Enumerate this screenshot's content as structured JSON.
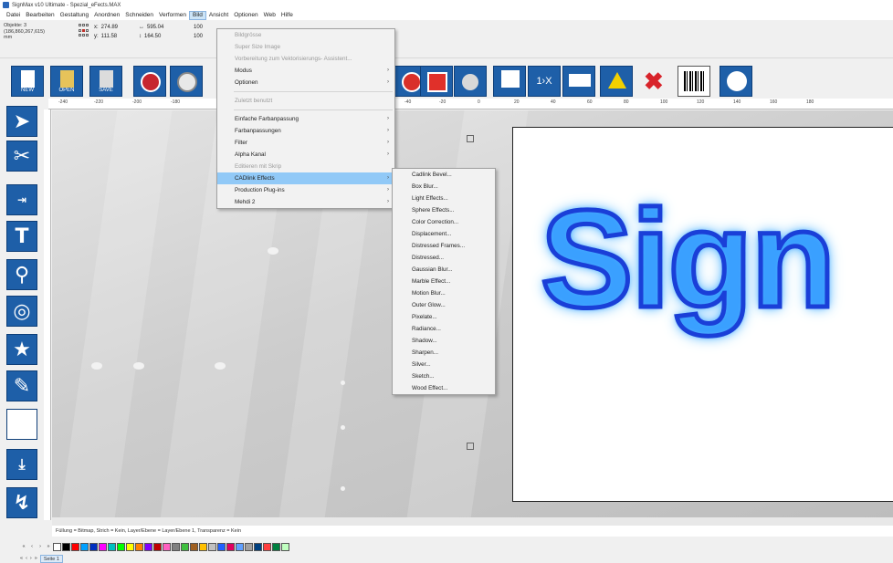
{
  "window": {
    "title": "SignMax v10 Ultimate - Spezial_eFects.MAX"
  },
  "menubar": {
    "items": [
      "Datei",
      "Bearbeiten",
      "Gestaltung",
      "Anordnen",
      "Schneiden",
      "Verformen",
      "Bild",
      "Ansicht",
      "Optionen",
      "Web",
      "Hilfe"
    ],
    "active": "Bild"
  },
  "object_info": {
    "line1": "Objekte: 3",
    "line2": "(186,860,267,615)",
    "line3": "mm"
  },
  "coords": {
    "x_label": "x:",
    "x": "274.89",
    "y_label": "y:",
    "y": "111.58",
    "w": "595.04",
    "h": "164.50",
    "sx": "100",
    "sy": "100"
  },
  "toolbar": {
    "new_label": "NEW",
    "open_label": "OPEN",
    "save_label": "SAVE"
  },
  "ruler_h_labels": [
    "-240",
    "-220",
    "-200",
    "-180",
    "-40",
    "-20",
    "0",
    "20",
    "40",
    "60",
    "80",
    "100",
    "120",
    "140",
    "160",
    "180"
  ],
  "bild_menu": {
    "items": [
      {
        "label": "Bildgrösse",
        "disabled": true,
        "submenu": false
      },
      {
        "label": "Super Size Image",
        "disabled": true,
        "submenu": false
      },
      {
        "label": "Vorbereitung zum Vektorisierungs- Assistent...",
        "disabled": true,
        "submenu": false
      },
      {
        "label": "Modus",
        "disabled": false,
        "submenu": true
      },
      {
        "label": "Optionen",
        "disabled": false,
        "submenu": true
      },
      {
        "label": "Zuletzt benutzt",
        "disabled": true,
        "submenu": false
      },
      {
        "label": "Einfache Farbanpassung",
        "disabled": false,
        "submenu": true
      },
      {
        "label": "Farbanpassungen",
        "disabled": false,
        "submenu": true
      },
      {
        "label": "Filter",
        "disabled": false,
        "submenu": true
      },
      {
        "label": "Alpha Kanal",
        "disabled": false,
        "submenu": true
      },
      {
        "label": "Editieren mit Skrip",
        "disabled": true,
        "submenu": false
      },
      {
        "label": "CADlink Effects",
        "disabled": false,
        "submenu": true,
        "highlighted": true
      },
      {
        "label": "Production Plug-ins",
        "disabled": false,
        "submenu": true
      },
      {
        "label": "Mehdi 2",
        "disabled": false,
        "submenu": true
      }
    ]
  },
  "effects_menu": {
    "items": [
      "Cadlink Bevel...",
      "Box Blur...",
      "Light Effects...",
      "Sphere Effects...",
      "Color Correction...",
      "Displacement...",
      "Distressed Frames...",
      "Distressed...",
      "Gaussian Blur...",
      "Marble Effect...",
      "Motion Blur...",
      "Outer Glow...",
      "Pixelate...",
      "Radiance...",
      "Shadow...",
      "Sharpen...",
      "Silver...",
      "Sketch...",
      "Wood Effect..."
    ]
  },
  "document": {
    "text": "Sign"
  },
  "status_bar": {
    "text": "Füllung = Bitmap, Strich = Kein, Layer/Ebene = Layer/Ebene 1, Transparenz = Kein"
  },
  "palette": {
    "colors": [
      "#ffffff",
      "#000000",
      "#ff0000",
      "#00a0ff",
      "#0030c0",
      "#ff00ff",
      "#00c0c0",
      "#00ff00",
      "#ffff00",
      "#ff8000",
      "#8000ff",
      "#c00000",
      "#ff60c0",
      "#808080",
      "#40c040",
      "#a06020",
      "#ffc000",
      "#c0c0c0",
      "#2060ff",
      "#e00060",
      "#60a0ff",
      "#a0a0a0",
      "#004080",
      "#ff4040",
      "#008040",
      "#c0ffc0"
    ]
  },
  "page_tabs": {
    "tab": "Seite 1"
  },
  "colors": {
    "tool_blue": "#1e5fa8",
    "menu_highlight": "#91c9f7",
    "sign_fill": "#2f6fb5"
  }
}
